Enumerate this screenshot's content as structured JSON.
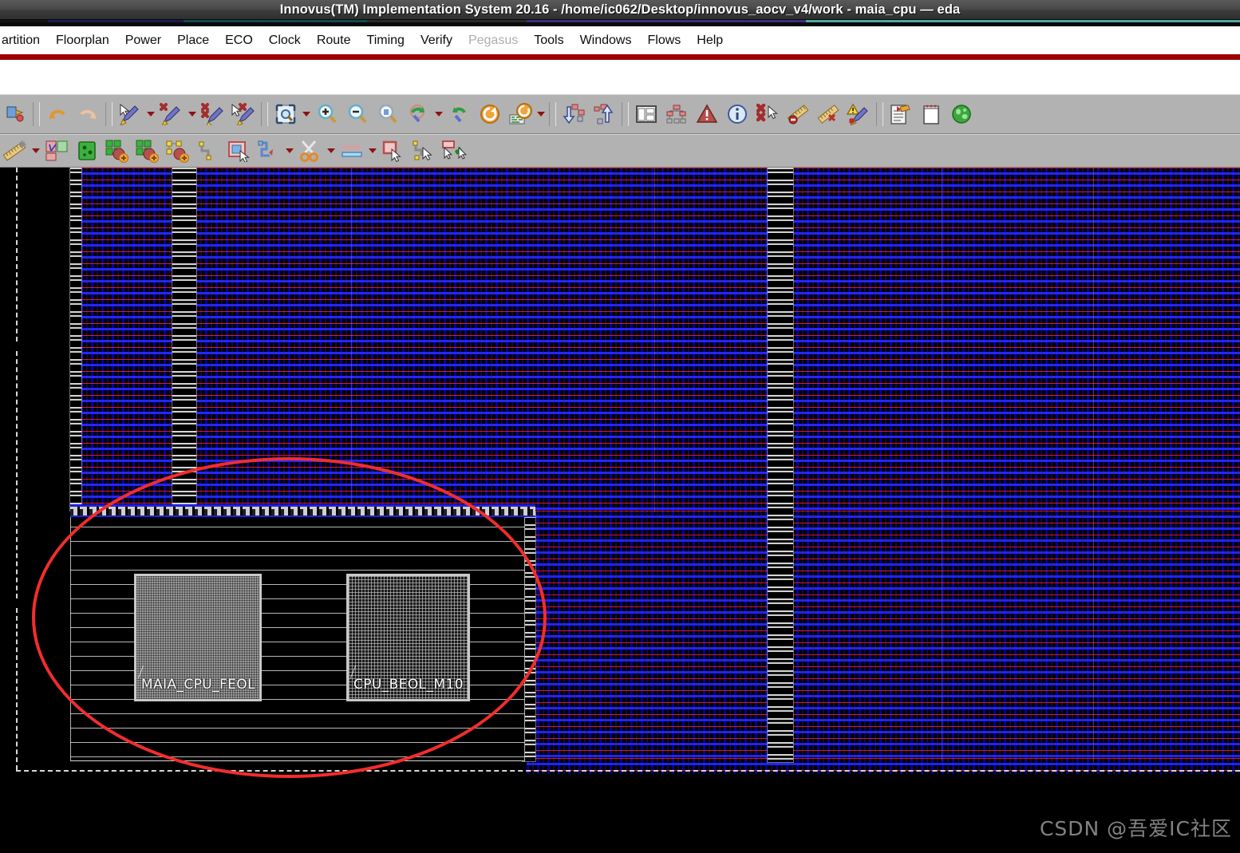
{
  "window": {
    "title": "Innovus(TM) Implementation System 20.16 - /home/ic062/Desktop/innovus_aocv_v4/work - maia_cpu — eda",
    "accent_red": "#9c0306",
    "toolbar_bg": "#b2b2b2"
  },
  "menubar": {
    "items": [
      {
        "label": "artition",
        "mnemonic": "o",
        "disabled": false
      },
      {
        "label": "Floorplan",
        "mnemonic": "a",
        "disabled": false
      },
      {
        "label": "Power",
        "mnemonic": "w",
        "disabled": false
      },
      {
        "label": "Place",
        "mnemonic": "P",
        "disabled": false
      },
      {
        "label": "ECO",
        "mnemonic": "O",
        "disabled": false
      },
      {
        "label": "Clock",
        "mnemonic": "C",
        "disabled": false
      },
      {
        "label": "Route",
        "mnemonic": "R",
        "disabled": false
      },
      {
        "label": "Timing",
        "mnemonic": "T",
        "disabled": false
      },
      {
        "label": "Verify",
        "mnemonic": "y",
        "disabled": false
      },
      {
        "label": "Pegasus",
        "mnemonic": "g",
        "disabled": true
      },
      {
        "label": "Tools",
        "mnemonic": "l",
        "disabled": false
      },
      {
        "label": "Windows",
        "mnemonic": "i",
        "disabled": false
      },
      {
        "label": "Flows",
        "mnemonic": "s",
        "disabled": false
      },
      {
        "label": "Help",
        "mnemonic": "H",
        "disabled": false
      }
    ]
  },
  "toolbar_row1": {
    "items": [
      {
        "icon": "design-import-icon",
        "kind": "btn"
      },
      {
        "icon": "separator",
        "kind": "sep"
      },
      {
        "icon": "undo-arrow-icon",
        "kind": "btn"
      },
      {
        "icon": "redo-arrow-icon",
        "kind": "btn"
      },
      {
        "icon": "separator",
        "kind": "sep"
      },
      {
        "icon": "select-cursor-pen-icon",
        "kind": "btn"
      },
      {
        "icon": "dropdown-arrow",
        "kind": "arrow"
      },
      {
        "icon": "deselect-pen-icon",
        "kind": "btn"
      },
      {
        "icon": "dropdown-arrow",
        "kind": "arrow"
      },
      {
        "icon": "clear-highlight-pen-icon",
        "kind": "btn"
      },
      {
        "icon": "select-deselect-cursor-icon",
        "kind": "btn"
      },
      {
        "icon": "separator",
        "kind": "sep"
      },
      {
        "icon": "fit-window-icon",
        "kind": "btn"
      },
      {
        "icon": "dropdown-arrow",
        "kind": "arrow"
      },
      {
        "icon": "zoom-in-icon",
        "kind": "btn"
      },
      {
        "icon": "zoom-out-icon",
        "kind": "btn"
      },
      {
        "icon": "zoom-selected-icon",
        "kind": "btn"
      },
      {
        "icon": "zoom-previous-icon",
        "kind": "btn"
      },
      {
        "icon": "dropdown-arrow",
        "kind": "arrow"
      },
      {
        "icon": "zoom-next-icon",
        "kind": "btn"
      },
      {
        "icon": "redraw-icon",
        "kind": "btn"
      },
      {
        "icon": "refresh-design-icon",
        "kind": "btn"
      },
      {
        "icon": "dropdown-arrow",
        "kind": "arrow"
      },
      {
        "icon": "separator",
        "kind": "sep"
      },
      {
        "icon": "hier-down-icon",
        "kind": "btn"
      },
      {
        "icon": "hier-up-icon",
        "kind": "btn"
      },
      {
        "icon": "separator",
        "kind": "sep"
      },
      {
        "icon": "layout-panel-icon",
        "kind": "btn"
      },
      {
        "icon": "hierarchy-tree-icon",
        "kind": "btn"
      },
      {
        "icon": "violation-browser-icon",
        "kind": "btn"
      },
      {
        "icon": "design-info-icon",
        "kind": "btn"
      },
      {
        "icon": "clear-violations-icon",
        "kind": "btn"
      },
      {
        "icon": "ruler-icon",
        "kind": "btn"
      },
      {
        "icon": "clear-ruler-icon",
        "kind": "btn"
      },
      {
        "icon": "violation-pen-icon",
        "kind": "btn"
      },
      {
        "icon": "separator",
        "kind": "sep"
      },
      {
        "icon": "report-edit-icon",
        "kind": "btn"
      },
      {
        "icon": "notepad-icon",
        "kind": "btn"
      },
      {
        "icon": "globe-icon",
        "kind": "btn"
      }
    ]
  },
  "toolbar_row2": {
    "items": [
      {
        "icon": "ruler-measure-icon",
        "kind": "btn"
      },
      {
        "icon": "dropdown-arrow",
        "kind": "arrow"
      },
      {
        "icon": "partition-icon",
        "kind": "btn"
      },
      {
        "icon": "module-green-icon",
        "kind": "btn"
      },
      {
        "icon": "add-blockage-icon",
        "kind": "btn"
      },
      {
        "icon": "add-halo-icon",
        "kind": "btn"
      },
      {
        "icon": "add-pin-guide-icon",
        "kind": "btn"
      },
      {
        "icon": "route-path-icon",
        "kind": "btn"
      },
      {
        "icon": "edit-select-region-icon",
        "kind": "btn"
      },
      {
        "icon": "wire-edit-icon",
        "kind": "btn"
      },
      {
        "icon": "dropdown-arrow",
        "kind": "arrow"
      },
      {
        "icon": "cut-wire-scissors-icon",
        "kind": "btn"
      },
      {
        "icon": "dropdown-arrow",
        "kind": "arrow"
      },
      {
        "icon": "stretch-wire-icon",
        "kind": "btn"
      },
      {
        "icon": "dropdown-arrow",
        "kind": "arrow"
      },
      {
        "icon": "move-object-icon",
        "kind": "btn"
      },
      {
        "icon": "move-pin-icon",
        "kind": "btn"
      },
      {
        "icon": "swap-object-icon",
        "kind": "btn"
      }
    ]
  },
  "canvas": {
    "background": "#000000",
    "macros": [
      {
        "name": "MAIA_CPU_FEOL",
        "fill": "#9a9a9a",
        "style": "feol"
      },
      {
        "name": "CPU_BEOL_M10",
        "fill": "#1c1c1c",
        "style": "beol"
      }
    ],
    "annotation": {
      "shape": "ellipse",
      "color": "#f22d2d",
      "note": "highlighted empty placement region containing the two macros"
    },
    "colors": {
      "std_cell_blue": "#2020e0",
      "std_cell_red": "#ff1e1e",
      "macro_outline": "#c9c9c9",
      "row_line": "#d7d7d7",
      "die_boundary": "#d8d8d8"
    }
  },
  "watermark": {
    "text": "CSDN @吾爱IC社区"
  }
}
